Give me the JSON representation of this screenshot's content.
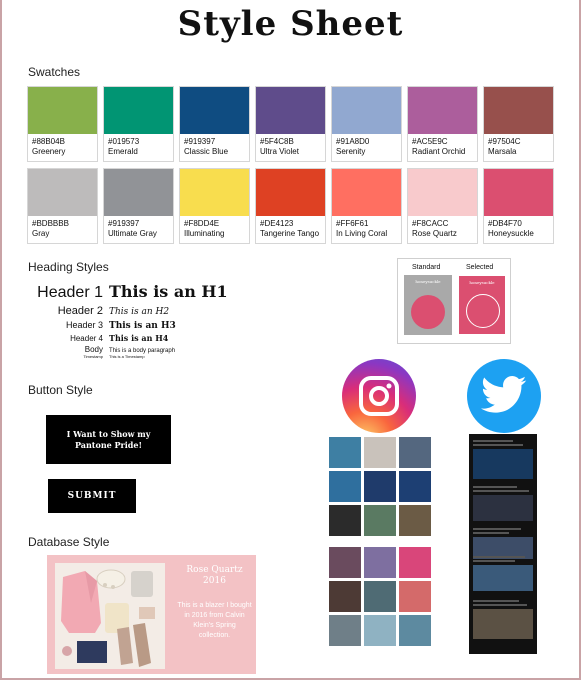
{
  "page": {
    "title": "Style Sheet"
  },
  "sections": {
    "swatches": "Swatches",
    "heading_styles": "Heading Styles",
    "button_style": "Button Style",
    "database_style": "Database Style"
  },
  "swatches": [
    {
      "hex": "#88B04B",
      "name": "Greenery",
      "color": "#88B04B"
    },
    {
      "hex": "#019573",
      "name": "Emerald",
      "color": "#019573"
    },
    {
      "hex": "#919397",
      "name": "Classic Blue",
      "color": "#0F4C81"
    },
    {
      "hex": "#5F4C8B",
      "name": "Ultra Violet",
      "color": "#5F4C8B"
    },
    {
      "hex": "#91A8D0",
      "name": "Serenity",
      "color": "#91A8D0"
    },
    {
      "hex": "#AC5E9C",
      "name": "Radiant Orchid",
      "color": "#AC5E9C"
    },
    {
      "hex": "#97504C",
      "name": "Marsala",
      "color": "#97504C"
    },
    {
      "hex": "#BDBBBB",
      "name": "Gray",
      "color": "#BDBBBB"
    },
    {
      "hex": "#919397",
      "name": "Ultimate Gray",
      "color": "#919397"
    },
    {
      "hex": "#F8DD4E",
      "name": "Illuminating",
      "color": "#F8DD4E"
    },
    {
      "hex": "#DE4123",
      "name": "Tangerine Tango",
      "color": "#DE4123"
    },
    {
      "hex": "#FF6F61",
      "name": "In Living Coral",
      "color": "#FF6F61"
    },
    {
      "hex": "#F8CACC",
      "name": "Rose Quartz",
      "color": "#F8CACC"
    },
    {
      "hex": "#DB4F70",
      "name": "Honeysuckle",
      "color": "#DB4F70"
    }
  ],
  "headings": [
    {
      "label": "Header 1",
      "sample": "This is an H1"
    },
    {
      "label": "Header 2",
      "sample": "This is an H2"
    },
    {
      "label": "Header 3",
      "sample": "This is an H3"
    },
    {
      "label": "Header 4",
      "sample": "This is an H4"
    },
    {
      "label": "Body",
      "sample": "This is a body paragraph"
    },
    {
      "label": "Timestamp",
      "sample": "This is a Timestamp"
    }
  ],
  "buttons": {
    "pride": "I Want to Show my Pantone Pride!",
    "submit": "SUBMIT"
  },
  "database": {
    "title": "Rose Quartz 2016",
    "description": "This is a blazer I bought in 2016 from Calvin Klein's Spring collection."
  },
  "states": {
    "standard": "Standard",
    "selected": "Selected",
    "card_name": "honeysuckle",
    "standard_bg": "#a9a9a9",
    "selected_bg": "#db4f70"
  },
  "icons": {
    "instagram": "instagram-icon",
    "twitter": "twitter-icon"
  }
}
